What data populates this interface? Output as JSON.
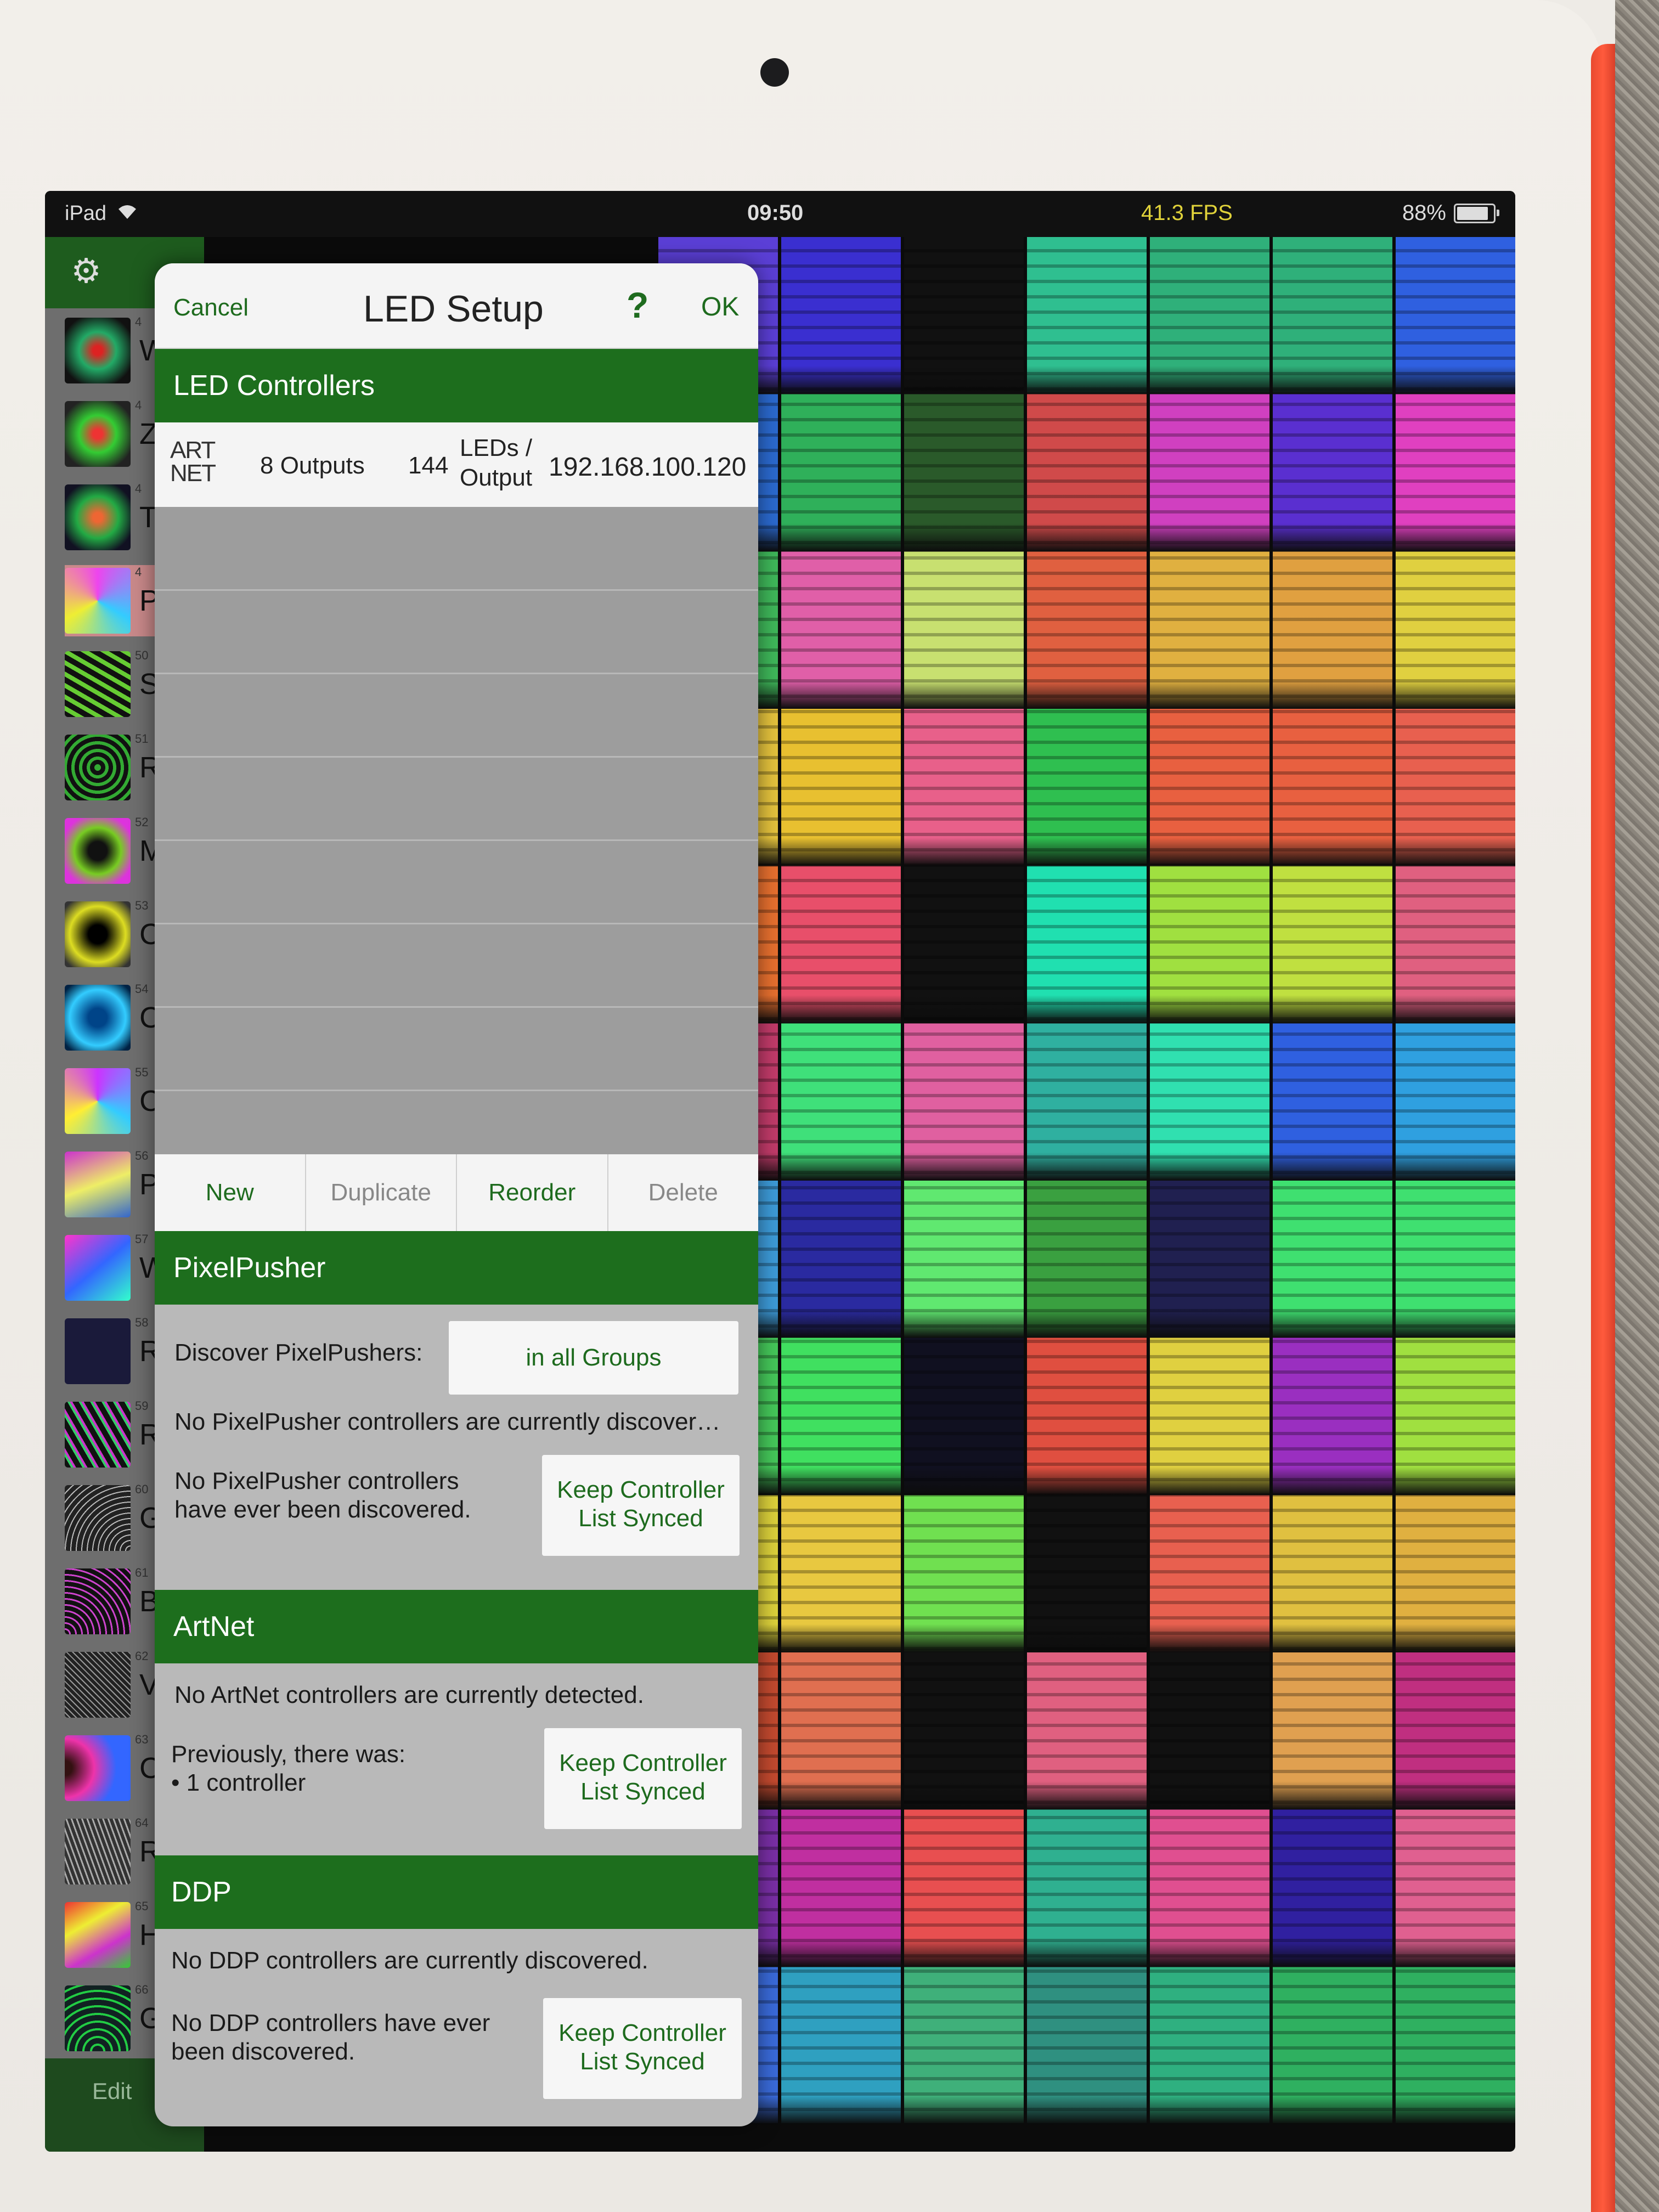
{
  "status_bar": {
    "device": "iPad",
    "time": "09:50",
    "fps": "41.3 FPS",
    "battery": "88%",
    "battery_level": 0.88
  },
  "sidebar": {
    "edit_label": "Edit",
    "items": [
      {
        "letter": "W",
        "num": "4"
      },
      {
        "letter": "Z",
        "num": "4"
      },
      {
        "letter": "T",
        "num": "4"
      },
      {
        "letter": "P",
        "num": "4",
        "selected": true
      },
      {
        "letter": "S",
        "num": "50"
      },
      {
        "letter": "R",
        "num": "51"
      },
      {
        "letter": "M",
        "num": "52"
      },
      {
        "letter": "C",
        "num": "53"
      },
      {
        "letter": "C",
        "num": "54"
      },
      {
        "letter": "C",
        "num": "55"
      },
      {
        "letter": "P",
        "num": "56"
      },
      {
        "letter": "W",
        "num": "57"
      },
      {
        "letter": "R",
        "num": "58"
      },
      {
        "letter": "R",
        "num": "59"
      },
      {
        "letter": "G",
        "num": "60"
      },
      {
        "letter": "B",
        "num": "61"
      },
      {
        "letter": "V",
        "num": "62"
      },
      {
        "letter": "C",
        "num": "63"
      },
      {
        "letter": "R",
        "num": "64"
      },
      {
        "letter": "H",
        "num": "65"
      },
      {
        "letter": "G",
        "num": "66"
      }
    ]
  },
  "dialog": {
    "cancel": "Cancel",
    "title": "LED Setup",
    "help": "?",
    "ok": "OK",
    "led_controllers": {
      "header": "LED Controllers",
      "row": {
        "logo_line1": "ART",
        "logo_line2": "NET",
        "outputs": "8 Outputs",
        "leds": "144",
        "leds_per_line1": "LEDs /",
        "leds_per_line2": "Output",
        "ip": "192.168.100.120"
      },
      "toolbar": {
        "new": "New",
        "duplicate": "Duplicate",
        "reorder": "Reorder",
        "delete": "Delete"
      }
    },
    "pixelpusher": {
      "header": "PixelPusher",
      "discover_label": "Discover PixelPushers:",
      "discover_value": "in all Groups",
      "status": "No PixelPusher controllers are currently discover…",
      "history_line1": "No PixelPusher controllers",
      "history_line2": "have ever been discovered.",
      "sync_line1": "Keep Controller",
      "sync_line2": "List Synced"
    },
    "artnet": {
      "header": "ArtNet",
      "status": "No ArtNet controllers are currently detected.",
      "history_line1": "Previously, there was:",
      "history_line2": "• 1 controller",
      "sync_line1": "Keep Controller",
      "sync_line2": "List Synced"
    },
    "ddp": {
      "header": "DDP",
      "status": "No DDP controllers are currently discovered.",
      "history_line1": "No DDP controllers have ever",
      "history_line2": "been discovered.",
      "sync_line1": "Keep Controller",
      "sync_line2": "List Synced"
    }
  }
}
